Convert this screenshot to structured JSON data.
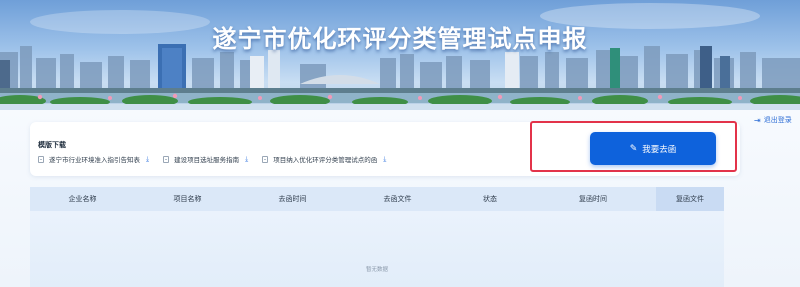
{
  "banner": {
    "title": "遂宁市优化环评分类管理试点申报"
  },
  "header": {
    "logout_label": "退出登录"
  },
  "templates": {
    "title": "模版下载",
    "items": [
      {
        "label": "遂宁市行业环境准入指引告知表"
      },
      {
        "label": "建设项目选址服务指南"
      },
      {
        "label": "项目纳入优化环评分类管理试点的函"
      }
    ]
  },
  "actions": {
    "submit_label": "我要去函"
  },
  "table": {
    "columns": [
      "企业名称",
      "项目名称",
      "去函时间",
      "去函文件",
      "状态",
      "复函时间",
      "复函文件"
    ],
    "empty_text": "暂无数据"
  },
  "colors": {
    "primary": "#0e62dc",
    "highlight_border": "#e3334a",
    "link": "#2f6fd6"
  },
  "icons": {
    "template_item": "document-icon",
    "download": "download-icon",
    "submit": "edit-pen-icon",
    "logout": "logout-icon"
  }
}
